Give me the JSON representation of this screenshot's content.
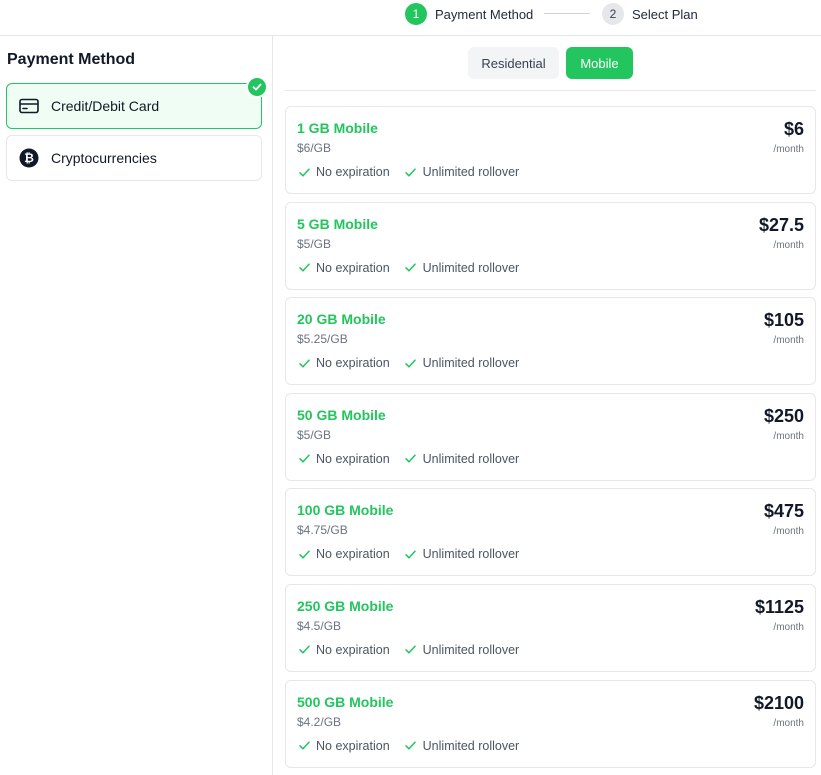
{
  "stepper": {
    "steps": [
      {
        "number": "1",
        "label": "Payment Method"
      },
      {
        "number": "2",
        "label": "Select Plan"
      }
    ]
  },
  "payment": {
    "title": "Payment Method",
    "methods": [
      {
        "label": "Credit/Debit Card",
        "icon": "credit-card-icon"
      },
      {
        "label": "Cryptocurrencies",
        "icon": "bitcoin-icon"
      }
    ]
  },
  "tabs": {
    "residential": "Residential",
    "mobile": "Mobile"
  },
  "colors": {
    "accent": "#22c55e",
    "selected_bg": "#f0fdf4",
    "border": "#e5e7eb"
  },
  "plans": [
    {
      "name": "1 GB Mobile",
      "rate": "$6/GB",
      "price": "$6",
      "period": "/month",
      "features": [
        "No expiration",
        "Unlimited rollover"
      ]
    },
    {
      "name": "5 GB Mobile",
      "rate": "$5/GB",
      "price": "$27.5",
      "period": "/month",
      "features": [
        "No expiration",
        "Unlimited rollover"
      ]
    },
    {
      "name": "20 GB Mobile",
      "rate": "$5.25/GB",
      "price": "$105",
      "period": "/month",
      "features": [
        "No expiration",
        "Unlimited rollover"
      ]
    },
    {
      "name": "50 GB Mobile",
      "rate": "$5/GB",
      "price": "$250",
      "period": "/month",
      "features": [
        "No expiration",
        "Unlimited rollover"
      ]
    },
    {
      "name": "100 GB Mobile",
      "rate": "$4.75/GB",
      "price": "$475",
      "period": "/month",
      "features": [
        "No expiration",
        "Unlimited rollover"
      ]
    },
    {
      "name": "250 GB Mobile",
      "rate": "$4.5/GB",
      "price": "$1125",
      "period": "/month",
      "features": [
        "No expiration",
        "Unlimited rollover"
      ]
    },
    {
      "name": "500 GB Mobile",
      "rate": "$4.2/GB",
      "price": "$2100",
      "period": "/month",
      "features": [
        "No expiration",
        "Unlimited rollover"
      ]
    }
  ]
}
